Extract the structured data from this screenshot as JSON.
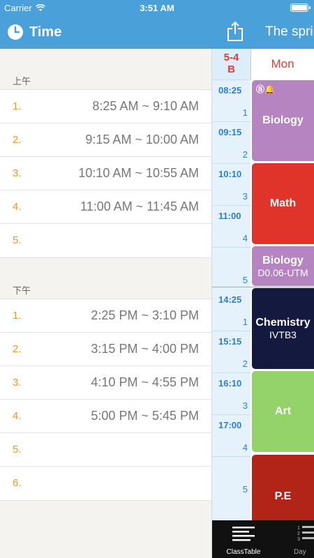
{
  "status": {
    "carrier": "Carrier",
    "time": "3:51 AM"
  },
  "nav": {
    "title": "Time",
    "semester": "The spri"
  },
  "left": {
    "morning": {
      "label": "上午",
      "rows": [
        {
          "num": "1.",
          "time": "8:25 AM ~ 9:10 AM"
        },
        {
          "num": "2.",
          "time": "9:15 AM ~ 10:00 AM"
        },
        {
          "num": "3.",
          "time": "10:10 AM ~ 10:55 AM"
        },
        {
          "num": "4.",
          "time": "11:00 AM ~ 11:45 AM"
        },
        {
          "num": "5.",
          "time": ""
        }
      ]
    },
    "afternoon": {
      "label": "下午",
      "rows": [
        {
          "num": "1.",
          "time": "2:25 PM ~ 3:10 PM"
        },
        {
          "num": "2.",
          "time": "3:15 PM ~ 4:00 PM"
        },
        {
          "num": "3.",
          "time": "4:10 PM ~ 4:55 PM"
        },
        {
          "num": "4.",
          "time": "5:00 PM ~ 5:45 PM"
        },
        {
          "num": "5.",
          "time": ""
        },
        {
          "num": "6.",
          "time": ""
        }
      ]
    }
  },
  "timetable": {
    "class_line1": "5-4",
    "class_line2": "B",
    "day": "Mon",
    "badge": "Ⓑ🔔",
    "periods": [
      {
        "start": "08:25",
        "idx": "1"
      },
      {
        "start": "09:15",
        "idx": "2"
      },
      {
        "start": "10:10",
        "idx": "3"
      },
      {
        "start": "11:00",
        "idx": "4"
      },
      {
        "start": "",
        "idx": "5"
      },
      {
        "start": "14:25",
        "idx": "1"
      },
      {
        "start": "15:15",
        "idx": "2"
      },
      {
        "start": "16:10",
        "idx": "3"
      },
      {
        "start": "17:00",
        "idx": "4"
      },
      {
        "start": "",
        "idx": "5"
      }
    ],
    "courses": [
      {
        "name": "Biology",
        "room": "",
        "color": "#b784c2"
      },
      {
        "name": "Math",
        "room": "",
        "color": "#e0342b"
      },
      {
        "name": "Biology",
        "room": "D0.06-UTM",
        "color": "#b784c2"
      },
      {
        "name": "Chemistry",
        "room": "IVTB3",
        "color": "#14193f"
      },
      {
        "name": "Art",
        "room": "",
        "color": "#94d36a"
      },
      {
        "name": "P.E",
        "room": "",
        "color": "#b22418"
      }
    ]
  },
  "tabs": [
    {
      "label": "ClassTable",
      "icon": "list-icon"
    },
    {
      "label": "Day",
      "icon": "numbered-list-icon"
    }
  ]
}
